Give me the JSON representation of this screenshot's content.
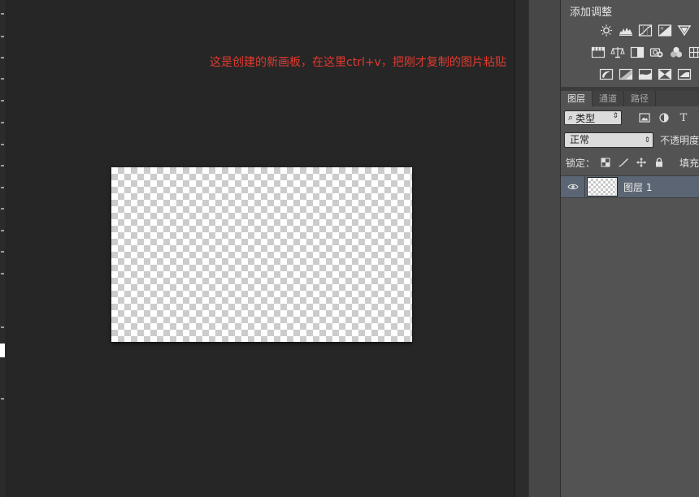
{
  "canvas": {
    "annotation": "这是创建的新画板，在这里ctrl+v，把刚才复制的图片粘贴",
    "annotation_color": "#e03a2f"
  },
  "adjustments": {
    "title": "添加调整",
    "row1_icons": [
      "brightness-icon",
      "levels-icon",
      "curves-icon",
      "exposure-icon",
      "vibrance-icon"
    ],
    "row2_icons": [
      "hue-saturation-icon",
      "color-balance-icon",
      "black-white-icon",
      "photo-filter-icon",
      "channel-mixer-icon",
      "color-lookup-icon"
    ],
    "row3_icons": [
      "invert-icon",
      "posterize-icon",
      "threshold-icon",
      "selective-color-icon",
      "gradient-map-icon"
    ]
  },
  "layers_panel": {
    "tabs": [
      {
        "label": "图层",
        "active": true
      },
      {
        "label": "通道",
        "active": false
      },
      {
        "label": "路径",
        "active": false
      }
    ],
    "filter": {
      "icon": "search-icon",
      "value": "类型"
    },
    "filter_type_glyph": "T",
    "blend_mode": "正常",
    "opacity_label": "不透明度",
    "lock_label": "锁定：",
    "fill_label": "填充",
    "layers": [
      {
        "name": "图层 1",
        "visible": true,
        "selected": true
      }
    ]
  },
  "colors": {
    "panel_bg": "#535353",
    "canvas_bg": "#262626",
    "selected_layer": "#5b6573"
  }
}
